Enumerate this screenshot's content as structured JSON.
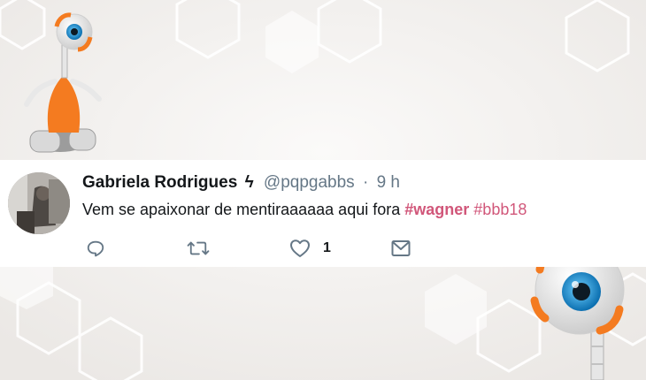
{
  "tweet": {
    "display_name": "Gabriela Rodrigues",
    "name_emoji": "ϟ",
    "handle": "@pqpgabbs",
    "separator": "·",
    "time": "9 h",
    "text": "Vem se apaixonar de mentiraaaaaa aqui fora ",
    "hashtags": [
      "#wagner",
      "#bbb18"
    ],
    "likes": "1"
  },
  "icons": [
    "reply-icon",
    "retweet-icon",
    "heart-icon",
    "message-icon"
  ],
  "colors": {
    "hashtag": "#d1577a",
    "muted": "#657786",
    "text": "#14171a",
    "mascot_orange": "#f47b20",
    "eye_blue": "#1f8fcf"
  }
}
